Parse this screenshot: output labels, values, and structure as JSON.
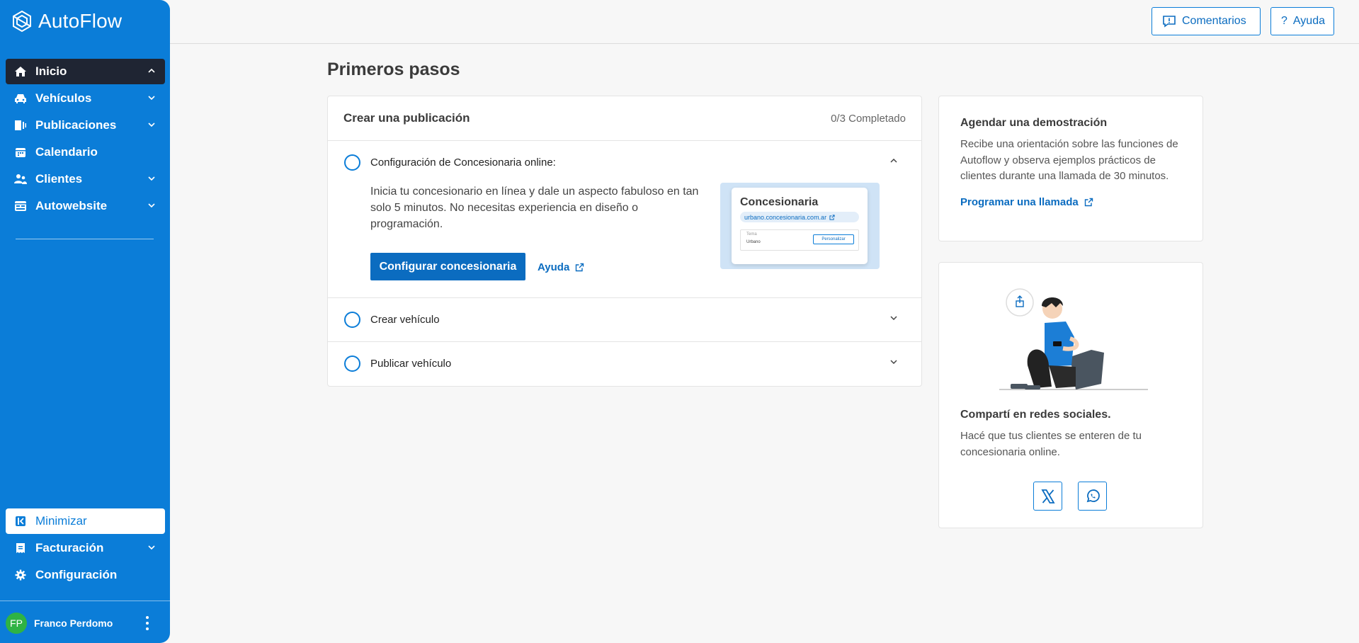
{
  "brand": {
    "name": "AutoFlow",
    "accent": "#0b7dd8",
    "sidebar_bg": "#0b7dd8",
    "active_bg": "#1f2533"
  },
  "sidebar": {
    "items": [
      {
        "label": "Inicio",
        "icon": "home-icon"
      },
      {
        "label": "Vehículos",
        "icon": "car-icon"
      },
      {
        "label": "Publicaciones",
        "icon": "publications-icon"
      },
      {
        "label": "Calendario",
        "icon": "calendar-icon"
      },
      {
        "label": "Clientes",
        "icon": "users-icon"
      },
      {
        "label": "Autowebsite",
        "icon": "website-icon"
      }
    ],
    "bottom_items": [
      {
        "label": "Minimizar",
        "icon": "collapse-icon"
      },
      {
        "label": "Facturación",
        "icon": "receipt-icon"
      },
      {
        "label": "Configuración",
        "icon": "gear-icon"
      }
    ],
    "user": {
      "initials": "FP",
      "name": "Franco Perdomo"
    }
  },
  "topbar": {
    "comments_label": "Comentarios",
    "help_label": "Ayuda",
    "help_prefix": "?"
  },
  "page": {
    "title": "Primeros pasos"
  },
  "steps": {
    "title": "Crear una publicación",
    "progress": "0/3 Completado",
    "items": [
      {
        "title": "Configuración de Concesionaria online:",
        "description": "Inicia tu concesionario en línea y dale un aspecto fabuloso en tan solo 5 minutos. No necesitas experiencia en diseño o programación.",
        "cta": "Configurar concesionaria",
        "help": "Ayuda",
        "preview": {
          "title": "Concesionaria",
          "url": "urbano.concesionaria.com.ar",
          "field_label": "Tema",
          "field_value": "Urbano",
          "button": "Personalizar"
        }
      },
      {
        "title": "Crear vehículo"
      },
      {
        "title": "Publicar vehículo"
      }
    ]
  },
  "demo": {
    "title": "Agendar una demostración",
    "description": "Recibe una orientación sobre las funciones de Autoflow y observa ejemplos prácticos de clientes durante una llamada de 30 minutos.",
    "link": "Programar una llamada"
  },
  "share": {
    "title": "Compartí en redes sociales.",
    "description": "Hacé que tus clientes se enteren de tu concesionaria online.",
    "networks": [
      "x-icon",
      "whatsapp-icon"
    ]
  }
}
